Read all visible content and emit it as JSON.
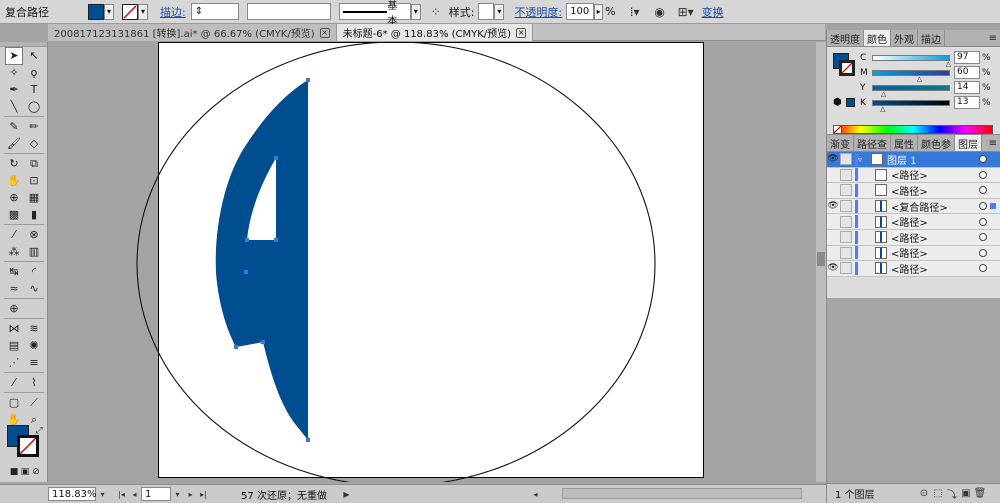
{
  "control": {
    "selection": "复合路径",
    "fill_color": "#004e8f",
    "stroke_link": "描边:",
    "stroke_style": "基本",
    "style_label": "样式:",
    "opacity_link": "不透明度:",
    "opacity_value": "100",
    "opacity_unit": "%",
    "transform_link": "变换"
  },
  "tabs": [
    {
      "label": "200817123131861 [转换].ai* @ 66.67% (CMYK/预览)"
    },
    {
      "label": "未标题-6* @ 118.83% (CMYK/预览)"
    }
  ],
  "tools": {
    "rows": [
      [
        "selection-tool-icon",
        "direct-selection-tool-icon"
      ],
      [
        "magic-wand-tool-icon",
        "lasso-tool-icon"
      ],
      [
        "pen-tool-icon",
        "type-tool-icon"
      ],
      [
        "line-tool-icon",
        "ellipse-tool-icon"
      ],
      [
        "paintbrush-tool-icon",
        "pencil-tool-icon"
      ],
      [
        "blob-brush-tool-icon",
        "eraser-tool-icon"
      ],
      [
        "rotate-tool-icon",
        "scale-tool-icon"
      ],
      [
        "warp-tool-icon",
        "free-transform-tool-icon"
      ],
      [
        "shape-builder-tool-icon",
        "perspective-grid-tool-icon"
      ],
      [
        "mesh-tool-icon",
        "gradient-tool-icon"
      ],
      [
        "eyedropper-tool-icon",
        "blend-tool-icon"
      ],
      [
        "symbol-sprayer-tool-icon",
        "column-graph-tool-icon"
      ],
      [
        "width-tool-icon",
        "arc-tool-icon"
      ],
      [
        "smooth-tool-icon",
        "wave-tool-icon"
      ],
      [
        "crosshair-tool-icon",
        ""
      ],
      [
        "envelope-tool-icon",
        "warp-wave-tool-icon"
      ],
      [
        "grid-tool-icon",
        "flare-tool-icon"
      ],
      [
        "scatter-tool-icon",
        "align-tool-icon"
      ],
      [
        "eyedropper-tool-icon",
        "measure-tool-icon"
      ],
      [
        "artboard-tool-icon",
        "slice-tool-icon"
      ],
      [
        "hand-tool-icon",
        "zoom-tool-icon"
      ]
    ],
    "glyphs": {
      "selection-tool-icon": "➤",
      "direct-selection-tool-icon": "↖",
      "magic-wand-tool-icon": "✧",
      "lasso-tool-icon": "ϙ",
      "pen-tool-icon": "✒",
      "type-tool-icon": "T",
      "line-tool-icon": "╲",
      "ellipse-tool-icon": "◯",
      "paintbrush-tool-icon": "✎",
      "pencil-tool-icon": "✏",
      "blob-brush-tool-icon": "🖌",
      "eraser-tool-icon": "◇",
      "rotate-tool-icon": "↻",
      "scale-tool-icon": "⧉",
      "warp-tool-icon": "✋",
      "free-transform-tool-icon": "⊡",
      "shape-builder-tool-icon": "⊕",
      "perspective-grid-tool-icon": "▦",
      "mesh-tool-icon": "▩",
      "gradient-tool-icon": "▮",
      "eyedropper-tool-icon": "⁄",
      "blend-tool-icon": "⊗",
      "symbol-sprayer-tool-icon": "⁂",
      "column-graph-tool-icon": "▥",
      "width-tool-icon": "↹",
      "arc-tool-icon": "◜",
      "smooth-tool-icon": "≈",
      "wave-tool-icon": "∿",
      "crosshair-tool-icon": "⊕",
      "envelope-tool-icon": "⋈",
      "warp-wave-tool-icon": "≋",
      "grid-tool-icon": "▤",
      "flare-tool-icon": "✺",
      "scatter-tool-icon": "⋰",
      "align-tool-icon": "≡",
      "measure-tool-icon": "⌇",
      "artboard-tool-icon": "▢",
      "slice-tool-icon": "⟋",
      "hand-tool-icon": "✋",
      "zoom-tool-icon": "⌕"
    },
    "fill_color": "#004e8f",
    "stroke_color": "#111111"
  },
  "art": {
    "shape_color": "#004e8f",
    "outline_color": "#111111"
  },
  "status": {
    "zoom": "118.83%",
    "page": "1",
    "info": "57 次还原；无重做"
  },
  "panels": {
    "top_tabs": [
      "透明度",
      "颜色",
      "外观",
      "描边"
    ],
    "color": {
      "swatch": "#004e8f",
      "channels": [
        {
          "letter": "C",
          "value": "97",
          "gradient": "linear-gradient(90deg,#fff,#00a0e4)",
          "pos": 97
        },
        {
          "letter": "M",
          "value": "60",
          "gradient": "linear-gradient(90deg,#00a0e4,#2a3c9a)",
          "pos": 60
        },
        {
          "letter": "Y",
          "value": "14",
          "gradient": "linear-gradient(90deg,#005ea8,#0a7a84)",
          "pos": 14
        },
        {
          "letter": "K",
          "value": "13",
          "gradient": "linear-gradient(90deg,#004e8f,#000)",
          "pos": 13
        }
      ],
      "unit": "%"
    },
    "layer_tabs": [
      "渐变",
      "路径查",
      "属性",
      "颜色参",
      "图层"
    ],
    "layers": [
      {
        "name": "图层 1",
        "level": 0,
        "eye": true
      },
      {
        "name": "<路径>",
        "level": 1,
        "eye": false
      },
      {
        "name": "<路径>",
        "level": 1,
        "eye": false
      },
      {
        "name": "<复合路径>",
        "level": 1,
        "eye": true
      },
      {
        "name": "<路径>",
        "level": 1,
        "eye": false
      },
      {
        "name": "<路径>",
        "level": 1,
        "eye": false
      },
      {
        "name": "<路径>",
        "level": 1,
        "eye": false
      },
      {
        "name": "<路径>",
        "level": 1,
        "eye": true
      }
    ],
    "footer_count": "1 个图层"
  }
}
